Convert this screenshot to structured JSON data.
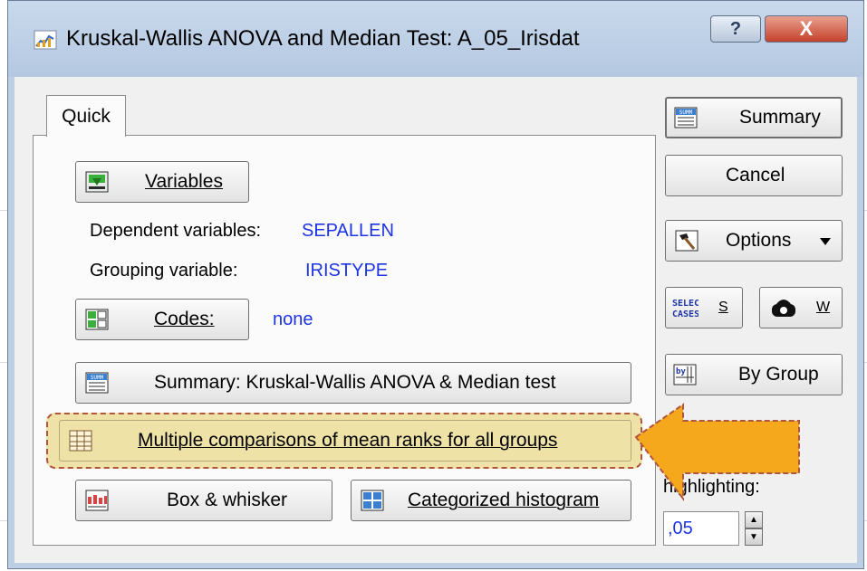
{
  "window": {
    "title": "Kruskal-Wallis ANOVA and Median Test: A_05_Irisdat",
    "help_label": "?",
    "close_label": "X"
  },
  "tabs": [
    {
      "label": "Quick"
    }
  ],
  "quick": {
    "variables_button": "Variables",
    "dependent_label": "Dependent variables:",
    "dependent_value": "SEPALLEN",
    "grouping_label": "Grouping variable:",
    "grouping_value": "IRISTYPE",
    "codes_button": "Codes:",
    "codes_value": "none",
    "summary_button": "Summary:  Kruskal-Wallis ANOVA  & Median test",
    "multiple_comparisons_button": "Multiple comparisons of mean ranks for all groups",
    "box_whisker_button": "Box & whisker",
    "categorized_histogram_button": "Categorized histogram"
  },
  "side": {
    "summary_button": "Summary",
    "cancel_button": "Cancel",
    "options_button": "Options",
    "select_cases_icon_text": "SELECT\nCASES",
    "select_cases_shortcut": "S",
    "weight_shortcut": "W",
    "by_group_button": "By Group",
    "highlighting_label": "highlighting:",
    "highlighting_value": ",05"
  },
  "icon_texts": {
    "summ": "SUMM",
    "by": "by"
  },
  "colors": {
    "value_text": "#1c34e4",
    "highlight_fill": "#efe2a7",
    "highlight_border": "#b0563f",
    "arrow_fill": "#f5a81c",
    "arrow_border": "#b0563f"
  }
}
